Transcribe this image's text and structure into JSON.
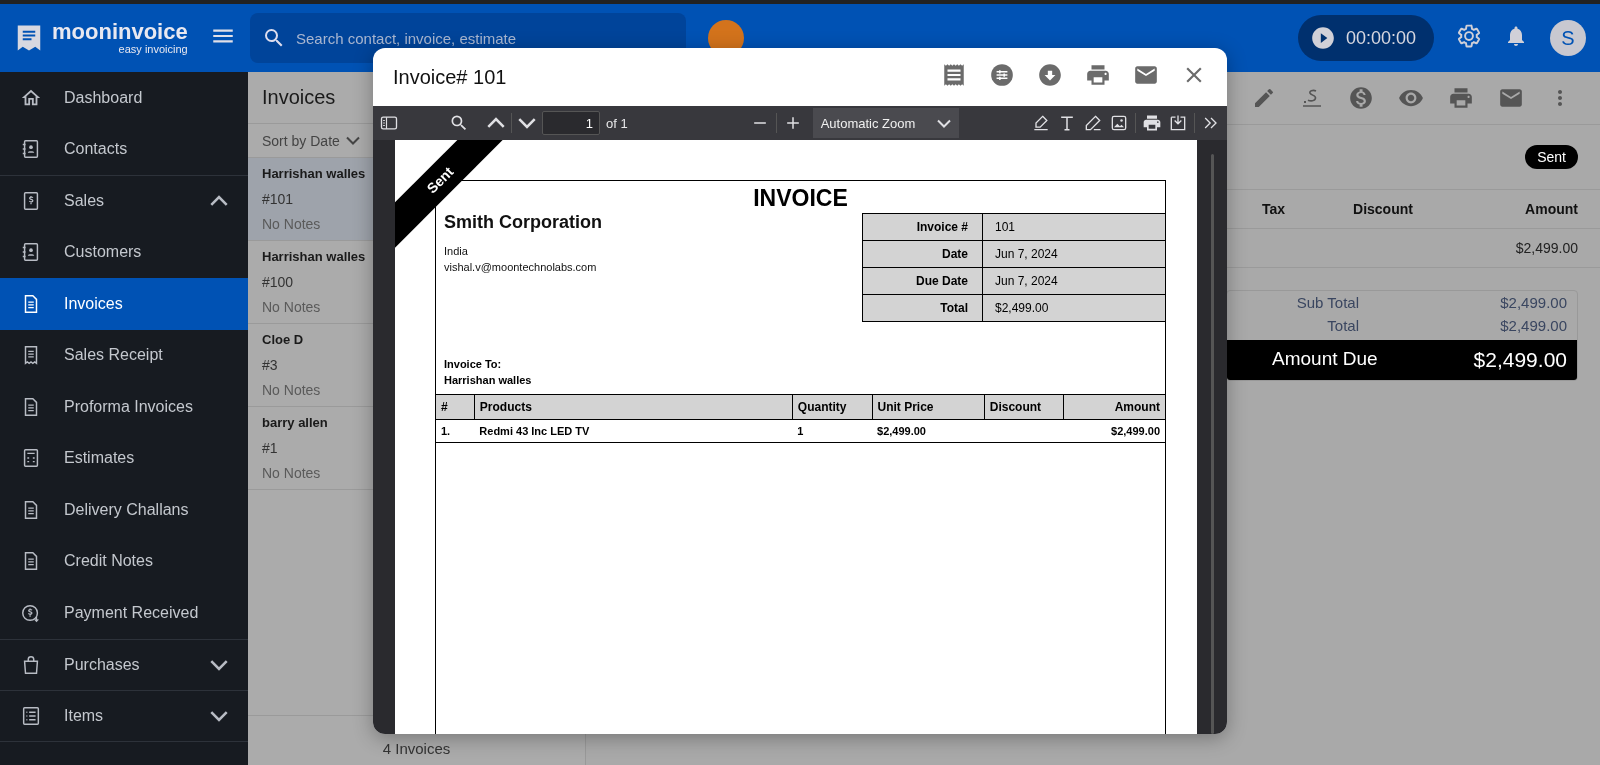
{
  "topbar": {
    "logo_name": "mooninvoice",
    "logo_tagline": "easy invoicing",
    "search": {
      "placeholder": "Search contact, invoice, estimate"
    },
    "timer": "00:00:00",
    "avatar_initial": "S"
  },
  "sidebar": {
    "items": [
      {
        "label": "Dashboard",
        "selected": false
      },
      {
        "label": "Contacts",
        "selected": false
      },
      {
        "label": "Sales",
        "selected": false,
        "expanded": true
      },
      {
        "label": "Customers",
        "selected": false
      },
      {
        "label": "Invoices",
        "selected": true
      },
      {
        "label": "Sales Receipt",
        "selected": false
      },
      {
        "label": "Proforma Invoices",
        "selected": false
      },
      {
        "label": "Estimates",
        "selected": false
      },
      {
        "label": "Delivery Challans",
        "selected": false
      },
      {
        "label": "Credit Notes",
        "selected": false
      },
      {
        "label": "Payment Received",
        "selected": false
      },
      {
        "label": "Purchases",
        "selected": false,
        "expanded": false
      },
      {
        "label": "Items",
        "selected": false,
        "expanded": false
      }
    ]
  },
  "invoice_list": {
    "title": "Invoices",
    "sort": "Sort by Date",
    "items": [
      {
        "name": "Harrishan walles",
        "number": "#101",
        "notes": "No Notes",
        "selected": true
      },
      {
        "name": "Harrishan walles",
        "number": "#100",
        "notes": "No Notes",
        "selected": false
      },
      {
        "name": "Cloe D",
        "number": "#3",
        "notes": "No Notes",
        "selected": false
      },
      {
        "name": "barry allen",
        "number": "#1",
        "notes": "No Notes",
        "selected": false
      }
    ],
    "footer": "4 Invoices"
  },
  "detail": {
    "status": "Sent",
    "columns": [
      "Tax",
      "Discount",
      "Amount"
    ],
    "rows": [
      {
        "amount": "$2,499.00"
      }
    ],
    "totals": [
      {
        "label": "Sub Total",
        "value": "$2,499.00"
      },
      {
        "label": "Total",
        "value": "$2,499.00"
      }
    ],
    "amount_due": {
      "label": "Amount Due",
      "value": "$2,499.00"
    }
  },
  "modal": {
    "title": "Invoice# 101",
    "viewer": {
      "page_number": "1",
      "page_count": "of 1",
      "zoom": "Automatic Zoom"
    },
    "document": {
      "ribbon": "Sent",
      "heading": "INVOICE",
      "company": "Smith Corporation",
      "address": [
        "India",
        "vishal.v@moontechnolabs.com"
      ],
      "meta": [
        {
          "label": "Invoice #",
          "value": "101"
        },
        {
          "label": "Date",
          "value": "Jun 7, 2024"
        },
        {
          "label": "Due Date",
          "value": "Jun 7, 2024"
        },
        {
          "label": "Total",
          "value": "$2,499.00"
        }
      ],
      "bill_to_label": "Invoice To:",
      "bill_to": "Harrishan walles",
      "columns": [
        "#",
        "Products",
        "Quantity",
        "Unit Price",
        "Discount",
        "Amount"
      ],
      "rows": [
        {
          "index": "1.",
          "product": "Redmi 43 Inc LED TV",
          "quantity": "1",
          "unit_price": "$2,499.00",
          "amount": "$2,499.00"
        }
      ]
    }
  }
}
